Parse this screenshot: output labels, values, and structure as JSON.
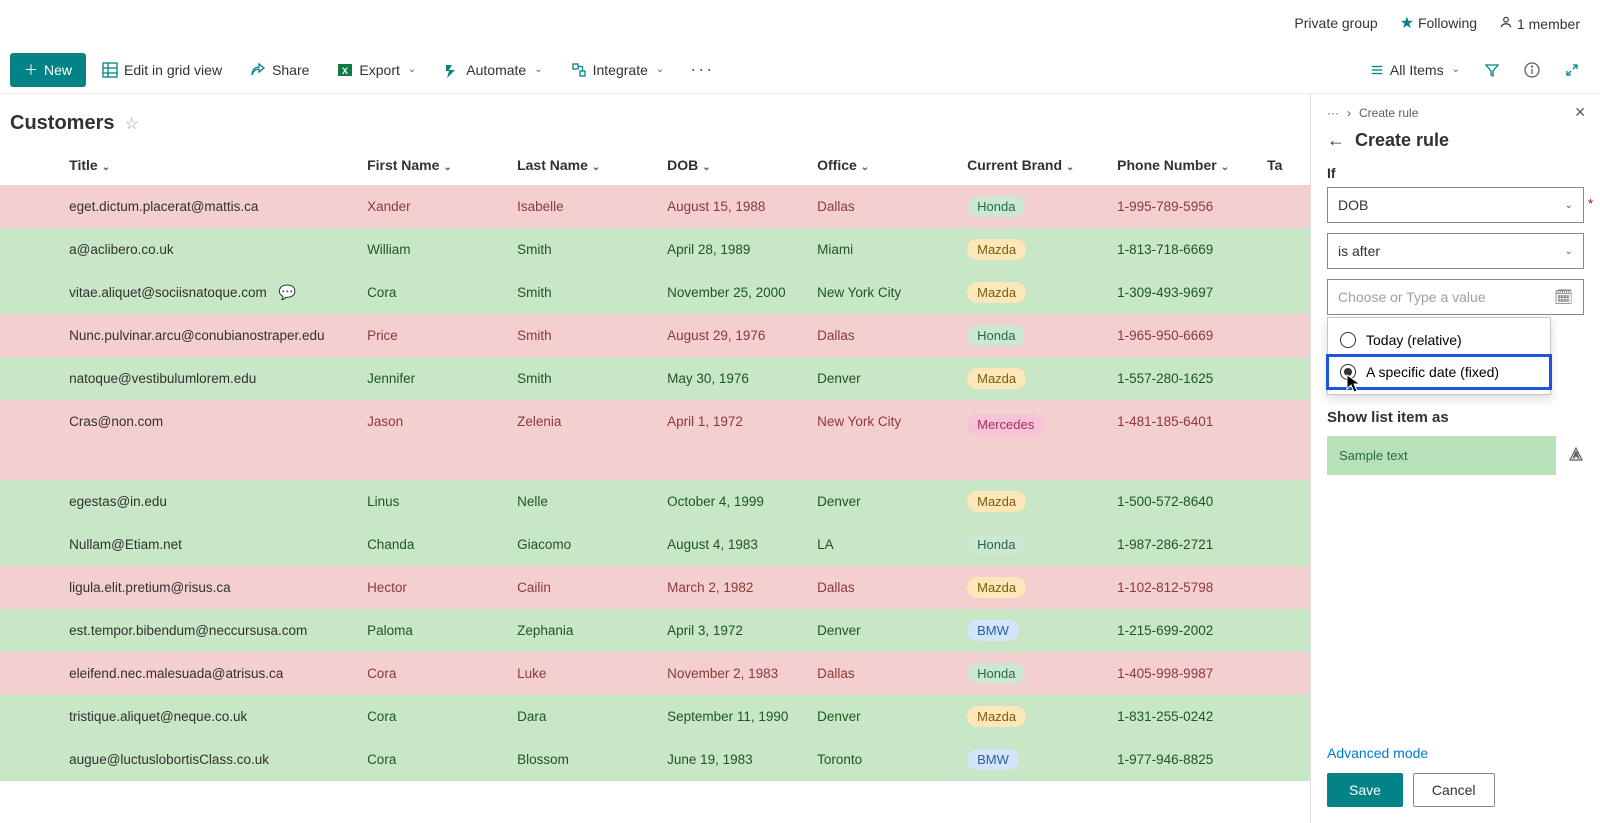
{
  "topbar": {
    "private_group": "Private group",
    "following": "Following",
    "member_count": "1 member"
  },
  "cmdbar": {
    "new": "New",
    "edit_grid": "Edit in grid view",
    "share": "Share",
    "export": "Export",
    "automate": "Automate",
    "integrate": "Integrate",
    "all_items": "All Items"
  },
  "list": {
    "title": "Customers"
  },
  "columns": {
    "title": "Title",
    "first_name": "First Name",
    "last_name": "Last Name",
    "dob": "DOB",
    "office": "Office",
    "brand": "Current Brand",
    "phone": "Phone Number",
    "ta": "Ta"
  },
  "rows": [
    {
      "rowcolor": "pink",
      "title": "eget.dictum.placerat@mattis.ca",
      "first": "Xander",
      "last": "Isabelle",
      "dob": "August 15, 1988",
      "office": "Dallas",
      "brand": "Honda",
      "brand_style": "honda",
      "phone": "1-995-789-5956"
    },
    {
      "rowcolor": "green",
      "title": "a@aclibero.co.uk",
      "first": "William",
      "last": "Smith",
      "dob": "April 28, 1989",
      "office": "Miami",
      "brand": "Mazda",
      "brand_style": "mazda",
      "phone": "1-813-718-6669"
    },
    {
      "rowcolor": "green",
      "title": "vitae.aliquet@sociisnatoque.com",
      "first": "Cora",
      "last": "Smith",
      "dob": "November 25, 2000",
      "office": "New York City",
      "brand": "Mazda",
      "brand_style": "mazda",
      "phone": "1-309-493-9697",
      "comment": true
    },
    {
      "rowcolor": "pink",
      "title": "Nunc.pulvinar.arcu@conubianostraper.edu",
      "first": "Price",
      "last": "Smith",
      "dob": "August 29, 1976",
      "office": "Dallas",
      "brand": "Honda",
      "brand_style": "honda",
      "phone": "1-965-950-6669"
    },
    {
      "rowcolor": "green",
      "title": "natoque@vestibulumlorem.edu",
      "first": "Jennifer",
      "last": "Smith",
      "dob": "May 30, 1976",
      "office": "Denver",
      "brand": "Mazda",
      "brand_style": "mazda",
      "phone": "1-557-280-1625"
    },
    {
      "rowcolor": "pink",
      "title": "Cras@non.com",
      "first": "Jason",
      "last": "Zelenia",
      "dob": "April 1, 1972",
      "office": "New York City",
      "brand": "Mercedes",
      "brand_style": "mercedes",
      "phone": "1-481-185-6401",
      "tall": true
    },
    {
      "rowcolor": "green",
      "title": "egestas@in.edu",
      "first": "Linus",
      "last": "Nelle",
      "dob": "October 4, 1999",
      "office": "Denver",
      "brand": "Mazda",
      "brand_style": "mazda",
      "phone": "1-500-572-8640"
    },
    {
      "rowcolor": "green",
      "title": "Nullam@Etiam.net",
      "first": "Chanda",
      "last": "Giacomo",
      "dob": "August 4, 1983",
      "office": "LA",
      "brand": "Honda",
      "brand_style": "honda",
      "phone": "1-987-286-2721"
    },
    {
      "rowcolor": "pink",
      "title": "ligula.elit.pretium@risus.ca",
      "first": "Hector",
      "last": "Cailin",
      "dob": "March 2, 1982",
      "office": "Dallas",
      "brand": "Mazda",
      "brand_style": "mazda",
      "phone": "1-102-812-5798"
    },
    {
      "rowcolor": "green",
      "title": "est.tempor.bibendum@neccursusa.com",
      "first": "Paloma",
      "last": "Zephania",
      "dob": "April 3, 1972",
      "office": "Denver",
      "brand": "BMW",
      "brand_style": "bmw",
      "phone": "1-215-699-2002"
    },
    {
      "rowcolor": "pink",
      "title": "eleifend.nec.malesuada@atrisus.ca",
      "first": "Cora",
      "last": "Luke",
      "dob": "November 2, 1983",
      "office": "Dallas",
      "brand": "Honda",
      "brand_style": "honda",
      "phone": "1-405-998-9987"
    },
    {
      "rowcolor": "green",
      "title": "tristique.aliquet@neque.co.uk",
      "first": "Cora",
      "last": "Dara",
      "dob": "September 11, 1990",
      "office": "Denver",
      "brand": "Mazda",
      "brand_style": "mazda",
      "phone": "1-831-255-0242"
    },
    {
      "rowcolor": "green",
      "title": "augue@luctuslobortisClass.co.uk",
      "first": "Cora",
      "last": "Blossom",
      "dob": "June 19, 1983",
      "office": "Toronto",
      "brand": "BMW",
      "brand_style": "bmw",
      "phone": "1-977-946-8825"
    }
  ],
  "panel": {
    "breadcrumb": "Create rule",
    "title": "Create rule",
    "if_label": "If",
    "field_select": "DOB",
    "condition_select": "is after",
    "value_placeholder": "Choose or Type a value",
    "option_today": "Today (relative)",
    "option_specific": "A specific date (fixed)",
    "show_as_label": "Show list item as",
    "sample_text": "Sample text",
    "advanced": "Advanced mode",
    "save": "Save",
    "cancel": "Cancel"
  }
}
